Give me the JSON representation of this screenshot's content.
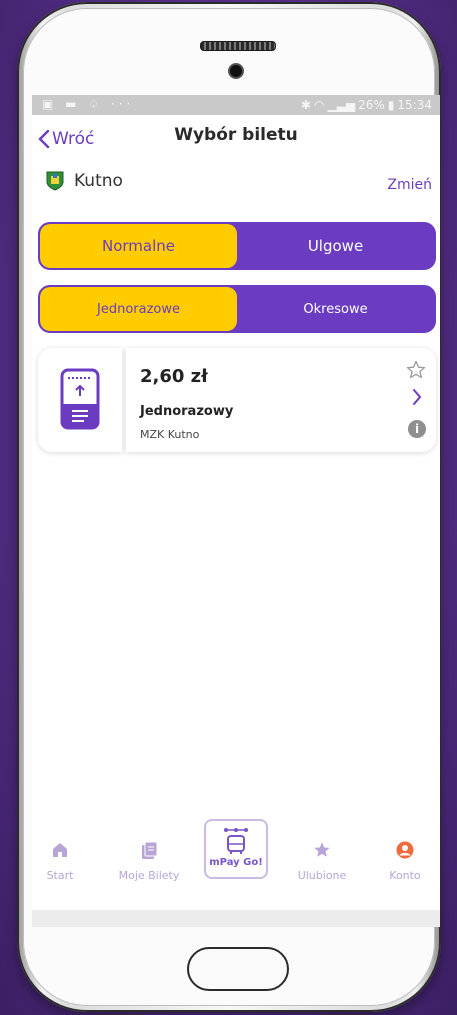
{
  "status_bar": {
    "battery": "26%",
    "time": "15:34"
  },
  "header": {
    "back_label": "Wróć",
    "title": "Wybór biletu"
  },
  "city": {
    "name": "Kutno",
    "change_label": "Zmień"
  },
  "fare_type": {
    "options": [
      "Normalne",
      "Ulgowe"
    ],
    "selected": "Normalne"
  },
  "ticket_kind": {
    "options": [
      "Jednorazowe",
      "Okresowe"
    ],
    "selected": "Jednorazowe"
  },
  "ticket": {
    "price": "2,60 zł",
    "name": "Jednorazowy",
    "operator": "MZK Kutno",
    "info": "i"
  },
  "tabbar": {
    "items": [
      {
        "label": "Start",
        "icon": "home-icon"
      },
      {
        "label": "Moje Bilety",
        "icon": "tickets-icon"
      },
      {
        "label": "mPay Go!",
        "icon": "bus-icon"
      },
      {
        "label": "Ulubione",
        "icon": "star-icon"
      },
      {
        "label": "Konto",
        "icon": "account-icon"
      }
    ]
  },
  "colors": {
    "accent": "#6b3cc1",
    "highlight": "#ffcc00",
    "tab_inactive": "#b8a5d6",
    "account": "#f06a3c"
  }
}
